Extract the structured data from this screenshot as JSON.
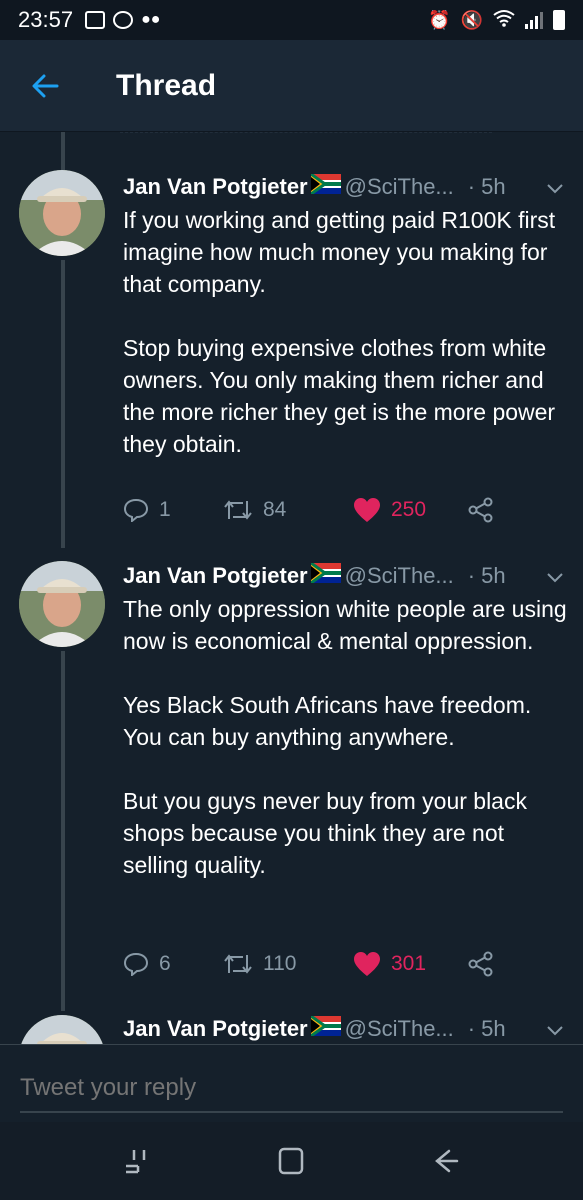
{
  "status_bar": {
    "time": "23:57"
  },
  "header": {
    "title": "Thread"
  },
  "colors": {
    "background": "#15202b",
    "accent": "#1da1f2",
    "like": "#e0245e",
    "muted": "#8899a6"
  },
  "tweets": [
    {
      "name": "Jan Van Potgieter",
      "handle": "@SciThe...",
      "dot": "·",
      "time": "5h",
      "text": "If you working and getting paid R100K first imagine how much money you making for that company.\n\nStop buying expensive clothes from white owners. You only making them richer and the more richer they get is the more power they obtain.",
      "replies": "1",
      "retweets": "84",
      "likes": "250",
      "liked": true
    },
    {
      "name": "Jan Van Potgieter",
      "handle": "@SciThe...",
      "dot": "·",
      "time": "5h",
      "text": "The only oppression white people are using now is economical & mental oppression.\n\nYes Black South Africans have freedom. You can buy anything anywhere.\n\nBut you guys never buy from your black shops because you think they are not selling quality.",
      "replies": "6",
      "retweets": "110",
      "likes": "301",
      "liked": true
    },
    {
      "name": "Jan Van Potgieter",
      "handle": "@SciThe...",
      "dot": "·",
      "time": "5h"
    }
  ],
  "reply_bar": {
    "placeholder": "Tweet your reply"
  },
  "icons": {
    "back": "arrow-left-icon",
    "reply": "comment-icon",
    "retweet": "retweet-icon",
    "like": "heart-icon",
    "share": "share-icon",
    "more": "chevron-down-icon"
  }
}
